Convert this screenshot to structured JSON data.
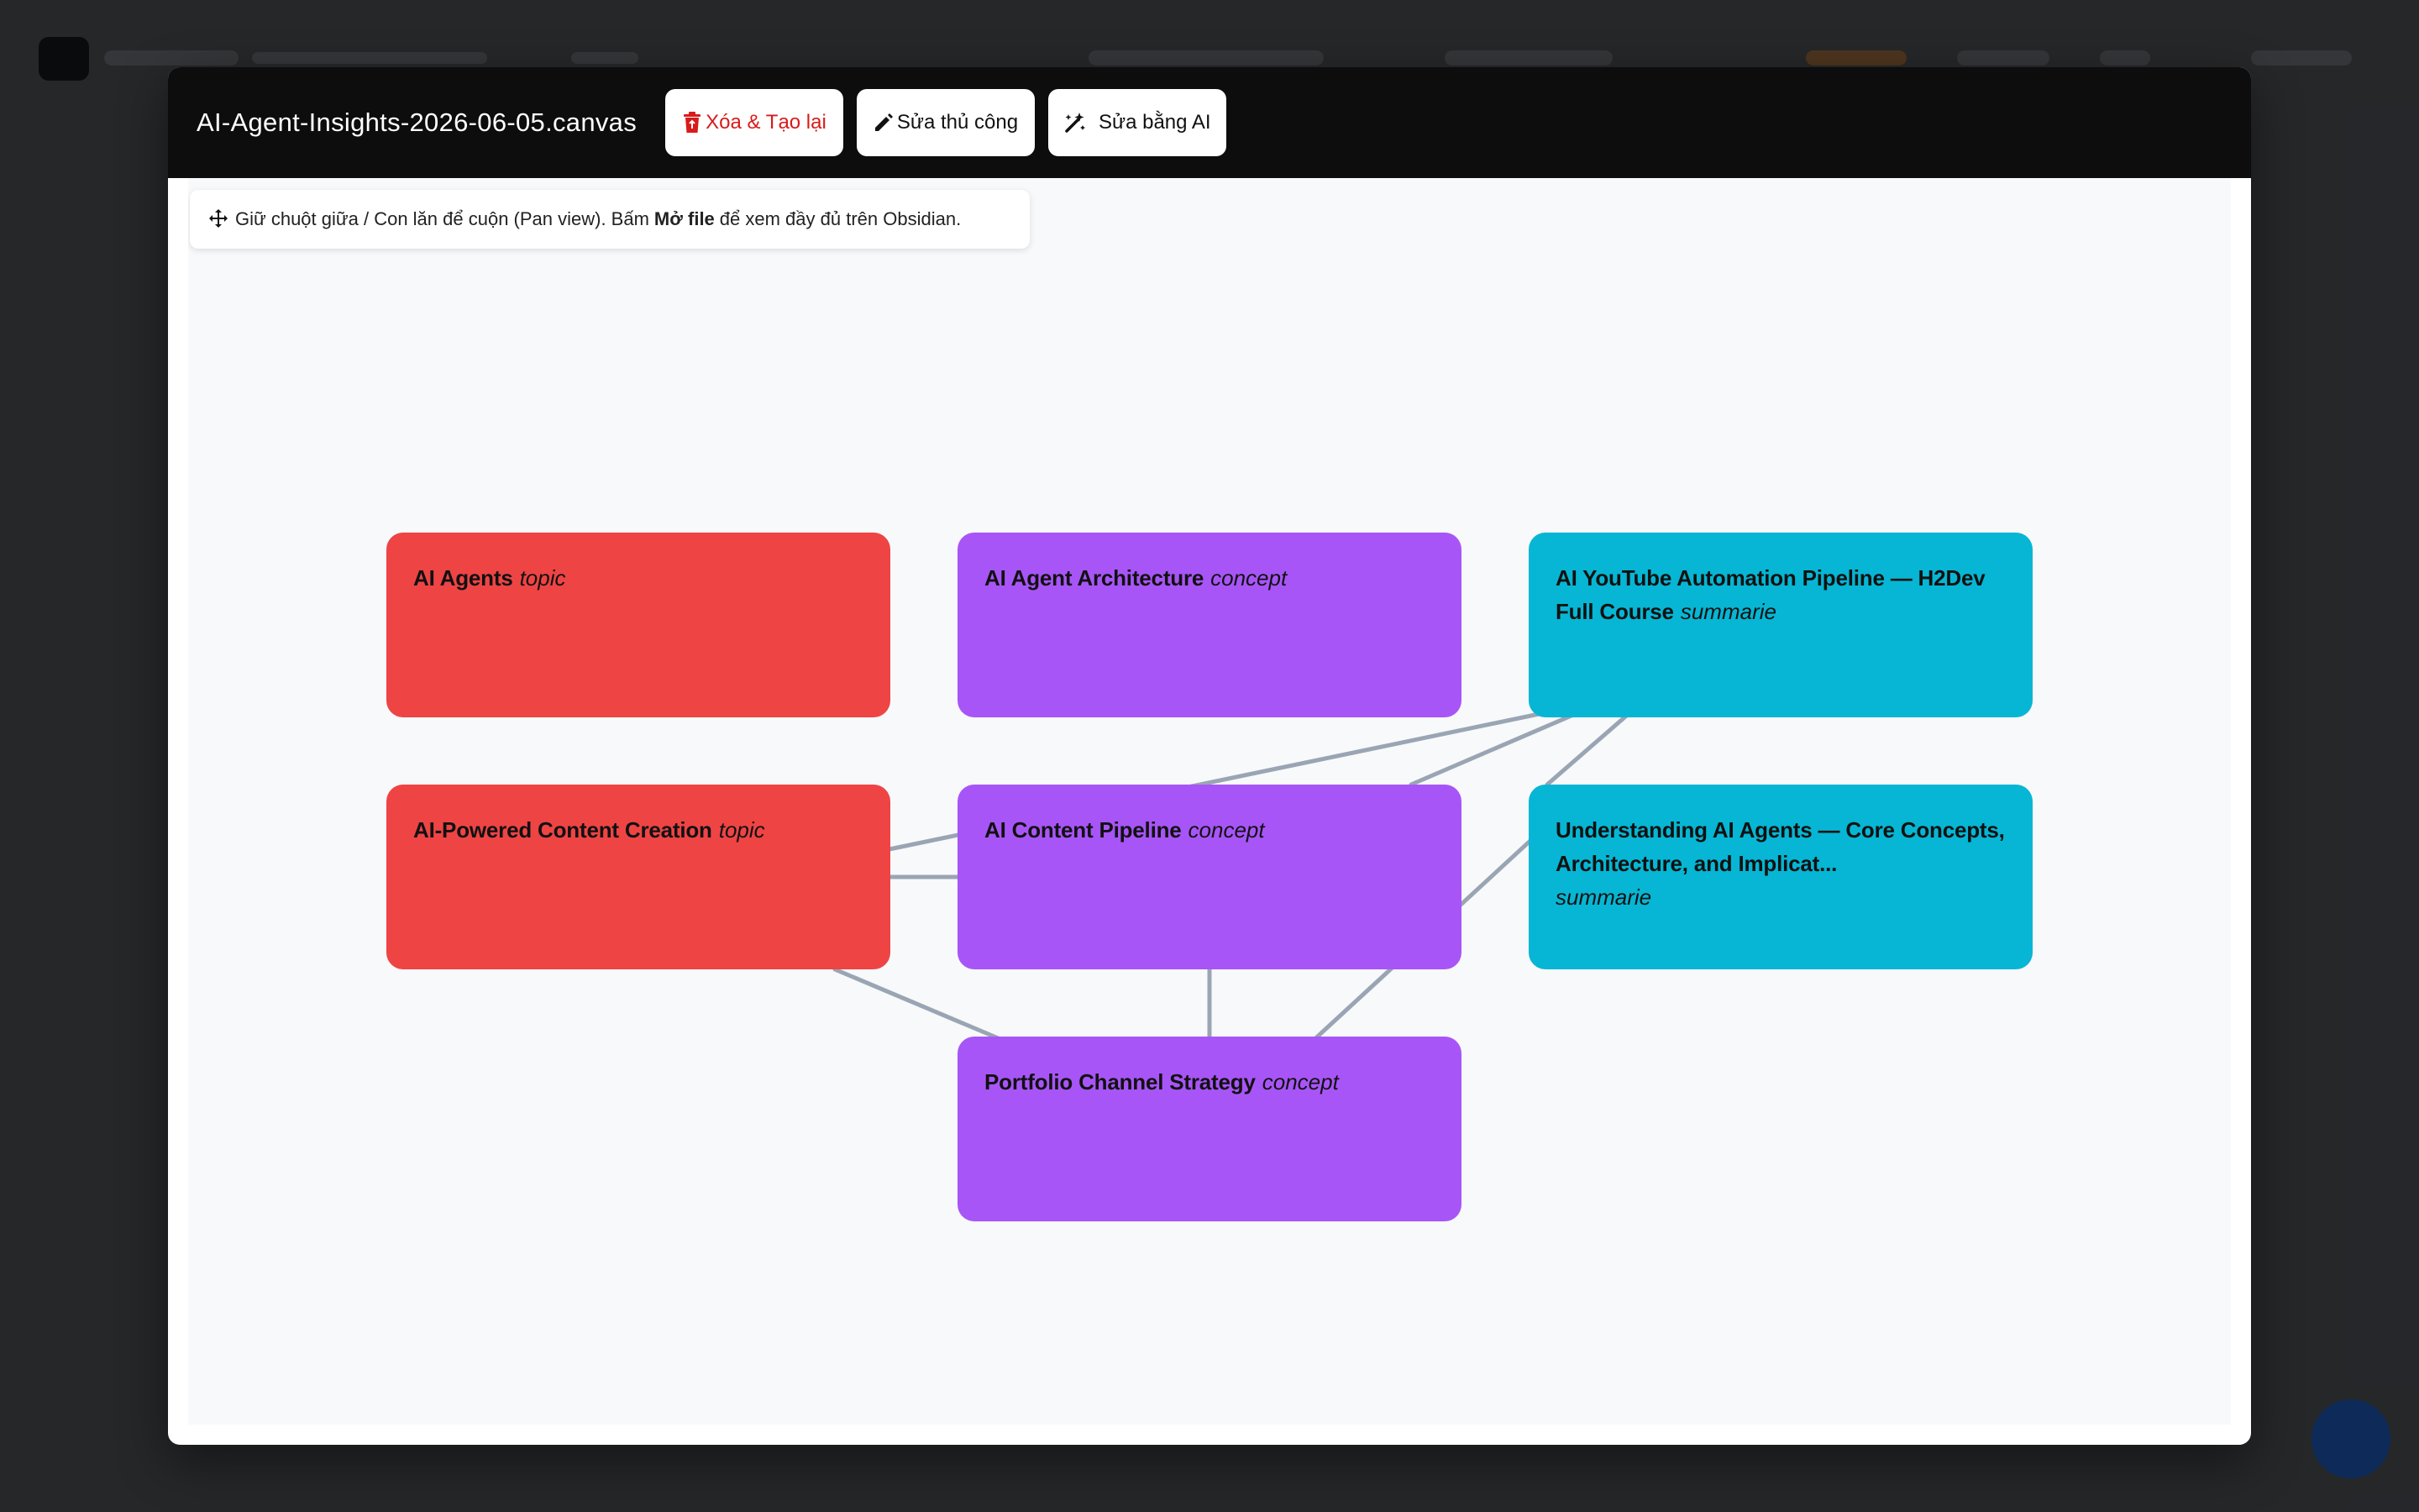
{
  "modal": {
    "title": "AI-Agent-Insights-2026-06-05.canvas",
    "buttons": {
      "delete_label": "Xóa & Tạo lại",
      "manual_label": "Sửa thủ công",
      "ai_label": "Sửa bằng AI"
    },
    "close_label": "×"
  },
  "hint": {
    "prefix": "Giữ chuột giữa / Con lăn để cuộn (Pan view). Bấm",
    "bold": "Mở file",
    "suffix": "để xem đầy đủ trên Obsidian."
  },
  "canvas": {
    "nodes": [
      {
        "id": "ai-agents",
        "title": "AI Agents",
        "type": "topic",
        "color": "#ef4444"
      },
      {
        "id": "ai-agent-architecture",
        "title": "AI Agent Architecture",
        "type": "concept",
        "color": "#a855f7"
      },
      {
        "id": "ai-youtube-pipeline",
        "title": "AI YouTube Automation Pipeline — H2Dev Full Course",
        "type": "summarie",
        "color": "#06b6d4"
      },
      {
        "id": "ai-powered-content",
        "title": "AI-Powered Content Creation",
        "type": "topic",
        "color": "#ef4444"
      },
      {
        "id": "ai-content-pipeline",
        "title": "AI Content Pipeline",
        "type": "concept",
        "color": "#a855f7"
      },
      {
        "id": "understanding-ai-agents",
        "title": "Understanding AI Agents — Core Concepts, Architecture, and Implicat...",
        "type": "summarie",
        "color": "#06b6d4"
      },
      {
        "id": "portfolio-channel",
        "title": "Portfolio Channel Strategy",
        "type": "concept",
        "color": "#a855f7"
      }
    ],
    "edges": [
      [
        "ai-powered-content",
        "ai-youtube-pipeline"
      ],
      [
        "ai-powered-content",
        "ai-content-pipeline"
      ],
      [
        "ai-powered-content",
        "portfolio-channel"
      ],
      [
        "ai-content-pipeline",
        "ai-youtube-pipeline"
      ],
      [
        "ai-content-pipeline",
        "portfolio-channel"
      ],
      [
        "portfolio-channel",
        "understanding-ai-agents"
      ],
      [
        "ai-content-pipeline",
        "ai-youtube-pipeline"
      ]
    ]
  },
  "colors": {
    "header": "#0d0d0e",
    "edge": "#9aa5b4",
    "delete": "#d81b1b"
  }
}
